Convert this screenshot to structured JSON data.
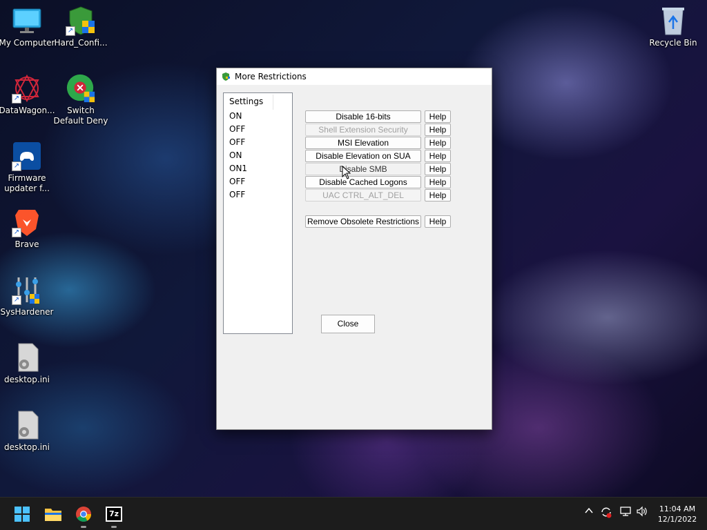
{
  "desktop": {
    "icons": [
      {
        "label": "My Computer"
      },
      {
        "label": "Hard_Confi..."
      },
      {
        "label": "DataWagon..."
      },
      {
        "label_line1": "Switch",
        "label_line2": "Default Deny"
      },
      {
        "label_line1": "Firmware",
        "label_line2": "updater f..."
      },
      {
        "label": "Brave"
      },
      {
        "label": "SysHardener"
      },
      {
        "label": "desktop.ini"
      },
      {
        "label": "desktop.ini"
      },
      {
        "label": "Recycle Bin"
      }
    ]
  },
  "dialog": {
    "title": "More Restrictions",
    "list_header": "Settings",
    "settings": [
      "ON",
      "OFF",
      "OFF",
      "ON",
      "ON1",
      "OFF",
      "OFF"
    ],
    "buttons": [
      {
        "label": "Disable 16-bits",
        "enabled": true
      },
      {
        "label": "Shell Extension Security",
        "enabled": false
      },
      {
        "label": "MSI Elevation",
        "enabled": true
      },
      {
        "label": "Disable Elevation on SUA",
        "enabled": true
      },
      {
        "label": "Disable SMB",
        "enabled": false
      },
      {
        "label": "Disable Cached Logons",
        "enabled": true
      },
      {
        "label": "UAC CTRL_ALT_DEL",
        "enabled": false
      }
    ],
    "remove_button": "Remove Obsolete Restrictions",
    "help_label": "Help",
    "close_label": "Close"
  },
  "taskbar": {
    "time": "11:04 AM",
    "date": "12/1/2022",
    "sevenzip_label": "7z"
  },
  "colors": {
    "taskbar": "#1c1c1c",
    "dialog_bg": "#f0f0f0",
    "windows_blue": "#4cc2ff"
  }
}
